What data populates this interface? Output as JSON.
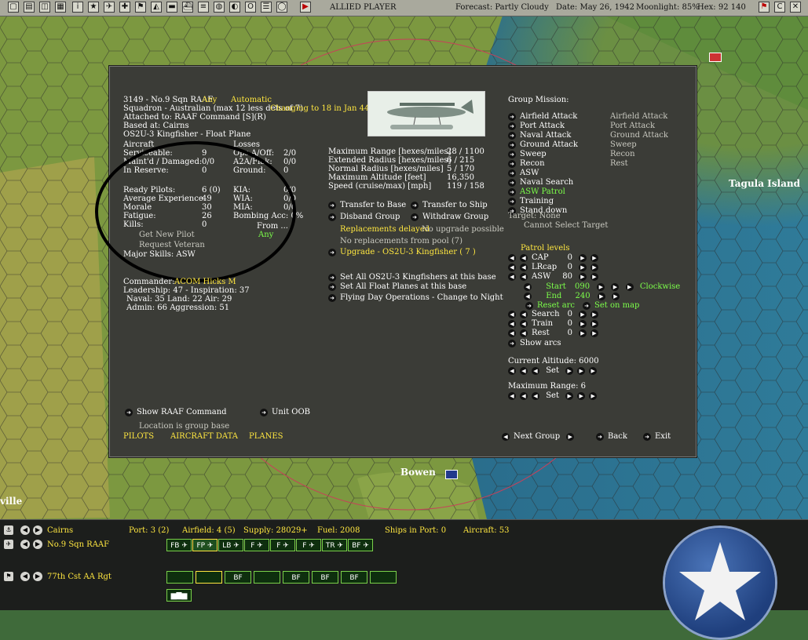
{
  "menubar": {
    "player": "ALLIED PLAYER",
    "forecast": "Forecast: Partly Cloudy",
    "date": "Date: May 26, 1942",
    "moonlight": "Moonlight: 85%",
    "hex": "Hex: 92 140",
    "icons": [
      "screen-icon",
      "grid-icon",
      "map-icon",
      "table-icon",
      "calendar-icon",
      "info-icon",
      "star-icon",
      "plane-icon",
      "cross-icon",
      "flag-icon",
      "chart-icon",
      "tank-icon",
      "ship-icon",
      "globe-icon",
      "globe2-icon",
      "od-icon",
      "list-icon",
      "circle-icon",
      "play-icon"
    ],
    "right_icons": [
      "flag-icon",
      "c-icon",
      "x-icon"
    ]
  },
  "map": {
    "labels": {
      "tagula": "Tagula Island",
      "bowen": "Bowen",
      "ville": "ville"
    }
  },
  "unit": {
    "line1_name": "3149 - No.9 Sqn RAAF",
    "line1_any": "Any",
    "line1_auto": "Automatic",
    "line2": "Squadron - Australian (max 12 less dets of 7)",
    "line2_change": "Changing to 18 in Jan 44",
    "attached": "Attached to:  RAAF Command [S](R)",
    "based": "Based at:  Cairns",
    "aircraft_type": "OS2U-3 Kingfisher - Float Plane"
  },
  "stats": {
    "hdr_aircraft": "Aircraft",
    "hdr_losses": "Losses",
    "serviceable_l": "Serviceable:",
    "serviceable_v": "9",
    "ops_l": "Ops A/Off:",
    "ops_v": "2/0",
    "maint_l": "Maint'd / Damaged:",
    "maint_v": "0/0",
    "a2a_l": "A2A/Flak:",
    "a2a_v": "0/0",
    "reserve_l": "In Reserve:",
    "reserve_v": "0",
    "ground_l": "Ground:",
    "ground_v": "0",
    "pilots_l": "Ready Pilots:",
    "pilots_v": "6 (0)",
    "kia_l": "KIA:",
    "kia_v": "0/0",
    "exp_l": "Average Experience",
    "exp_v": "49",
    "wia_l": "WIA:",
    "wia_v": "0/0",
    "morale_l": "Morale",
    "morale_v": "30",
    "mia_l": "MIA:",
    "mia_v": "0/0",
    "fatigue_l": "Fatigue:",
    "fatigue_v": "26",
    "bomb_l": "Bombing Acc: 0%",
    "kills_l": "Kills:",
    "kills_v": "0",
    "from_l": "From ...",
    "from_v": "Any",
    "get_pilot": "Get New Pilot",
    "request_vet": "Request Veteran",
    "skills": "Major Skills:  ASW"
  },
  "commander": {
    "name_l": "Commander:",
    "name_v": "ACOM Hicks M",
    "leadership": "Leadership: 47 - Inspiration: 37",
    "naval": "Naval:  35  Land:  22  Air:  29",
    "admin": "Admin:  66  Aggression:  51"
  },
  "perf": {
    "max_range_l": "Maximum Range [hexes/miles]",
    "max_range_v": "28 / 1100",
    "ext_radius_l": "Extended Radius [hexes/miles]",
    "ext_radius_v": "6 / 215",
    "norm_radius_l": "Normal Radius [hexes/miles]",
    "norm_radius_v": "5 / 170",
    "max_alt_l": "Maximum Altitude [feet]",
    "max_alt_v": "16,350",
    "speed_l": "Speed (cruise/max) [mph]",
    "speed_v": "119 / 158"
  },
  "actions": {
    "transfer_base": "Transfer to Base",
    "transfer_ship": "Transfer to Ship",
    "disband": "Disband Group",
    "withdraw": "Withdraw Group",
    "replacements_delayed": "Replacements delayed",
    "no_upgrade": "No upgrade possible",
    "no_replacements": "No replacements from pool (7)",
    "upgrade": "Upgrade - OS2U-3 Kingfisher ( 7 )",
    "set_all": "Set All OS2U-3 Kingfishers at this base",
    "set_float": "Set All Float Planes at this base",
    "flying_day": "Flying Day Operations - Change to Night"
  },
  "mission": {
    "title": "Group Mission:",
    "items": [
      "Airfield Attack",
      "Port Attack",
      "Naval Attack",
      "Ground Attack",
      "Sweep",
      "Recon",
      "ASW",
      "Naval Search",
      "ASW Patrol",
      "Training",
      "Stand down"
    ],
    "secondary": [
      "Airfield Attack",
      "Port Attack",
      "Ground Attack",
      "Sweep",
      "Recon",
      "Rest"
    ],
    "target": "Target: None",
    "cannot_select": "Cannot Select Target"
  },
  "patrol": {
    "title": "Patrol levels",
    "rows": [
      {
        "label": "CAP",
        "value": "0"
      },
      {
        "label": "LRcap",
        "value": "0"
      },
      {
        "label": "ASW",
        "value": "80"
      }
    ],
    "start_l": "Start",
    "start_v": "090",
    "end_l": "End",
    "end_v": "240",
    "clockwise": "Clockwise",
    "reset_arc": "Reset arc",
    "set_on_map": "Set on map",
    "rows2": [
      {
        "label": "Search",
        "value": "0"
      },
      {
        "label": "Train",
        "value": "0"
      },
      {
        "label": "Rest",
        "value": "0"
      }
    ],
    "show_arcs": "Show arcs",
    "altitude": "Current Altitude: 6000",
    "set": "Set",
    "max_range": "Maximum Range: 6"
  },
  "footer": {
    "show_raaf": "Show RAAF Command",
    "unit_oob": "Unit OOB",
    "location": "Location is group base",
    "tabs": [
      "PILOTS",
      "AIRCRAFT DATA",
      "PLANES"
    ],
    "next_group": "Next Group",
    "back": "Back",
    "exit": "Exit"
  },
  "bottom": {
    "base": "Cairns",
    "port": "Port: 3 (2)",
    "airfield": "Airfield: 4 (5)",
    "supply": "Supply: 28029+",
    "fuel": "Fuel: 2008",
    "ships": "Ships in Port: 0",
    "aircraft": "Aircraft: 53",
    "group": "No.9 Sqn RAAF",
    "ground_unit": "77th Cst AA Rgt",
    "air_chips": [
      "FB",
      "FP",
      "LB",
      "F",
      "F",
      "F",
      "TR",
      "BF"
    ],
    "ground_chips": [
      "",
      "",
      "BF",
      "",
      "BF",
      "BF",
      "BF",
      ""
    ]
  }
}
